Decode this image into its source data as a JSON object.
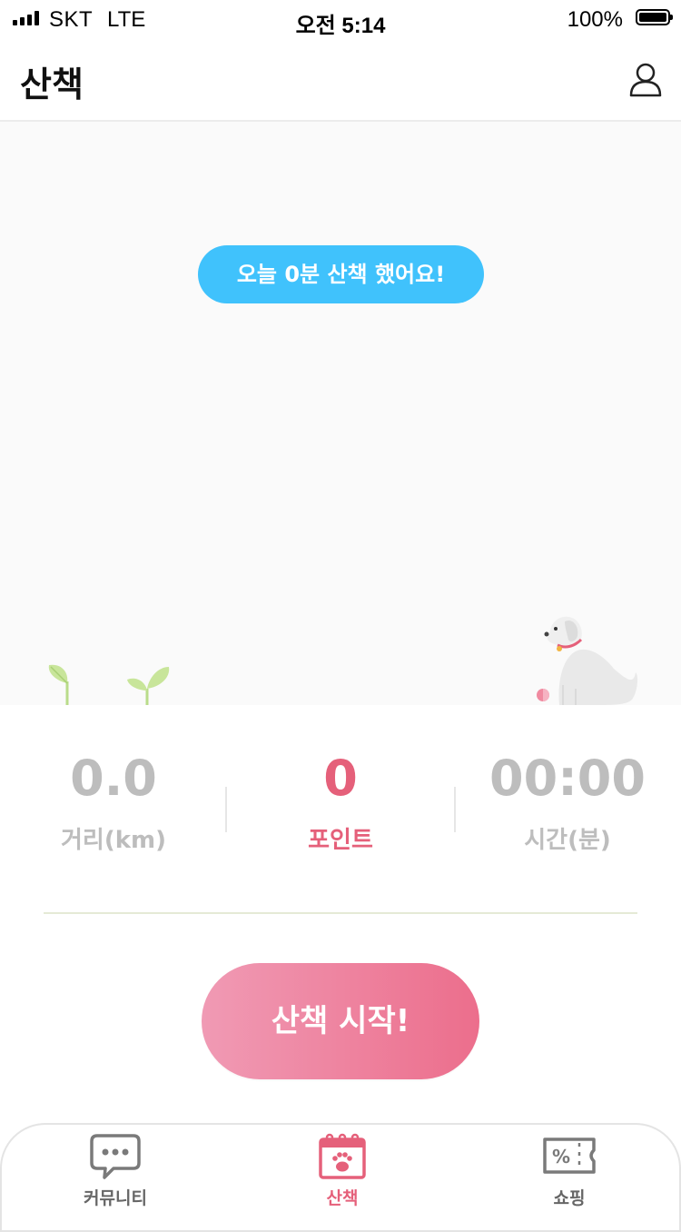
{
  "status_bar": {
    "carrier": "SKT",
    "network": "LTE",
    "time": "오전 5:14",
    "battery": "100%"
  },
  "header": {
    "title": "산책"
  },
  "walk": {
    "today_message": "오늘 0분 산책 했어요!"
  },
  "stats": {
    "distance": {
      "value": "0.0",
      "label": "거리(km)"
    },
    "point": {
      "value": "0",
      "label": "포인트"
    },
    "time": {
      "value": "00:00",
      "label": "시간(분)"
    }
  },
  "start_button": {
    "label": "산책 시작!"
  },
  "tabs": [
    {
      "label": "커뮤니티",
      "icon": "chat-bubble-icon",
      "active": false
    },
    {
      "label": "산책",
      "icon": "paw-calendar-icon",
      "active": true
    },
    {
      "label": "쇼핑",
      "icon": "coupon-icon",
      "active": false
    }
  ],
  "colors": {
    "accent_pink": "#e5607a",
    "pill_blue": "#40c2fc",
    "stat_gray": "#bdbdbd"
  }
}
